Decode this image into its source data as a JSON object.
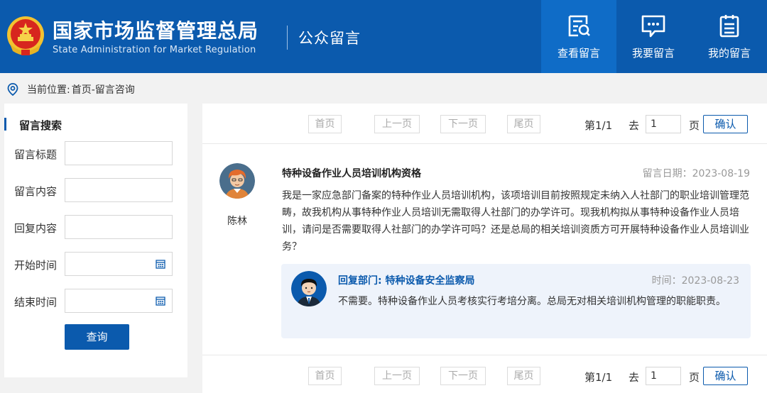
{
  "header": {
    "org_name_cn": "国家市场监督管理总局",
    "org_name_en": "State Administration for Market Regulation",
    "section_title": "公众留言",
    "nav": [
      {
        "label": "查看留言",
        "icon": "view-messages-icon",
        "active": true
      },
      {
        "label": "我要留言",
        "icon": "write-message-icon",
        "active": false
      },
      {
        "label": "我的留言",
        "icon": "my-messages-icon",
        "active": false
      }
    ]
  },
  "breadcrumb": {
    "label": "当前位置:",
    "path": "首页-留言咨询"
  },
  "sidebar": {
    "title": "留言搜索",
    "fields": [
      {
        "label": "留言标题",
        "value": ""
      },
      {
        "label": "留言内容",
        "value": ""
      },
      {
        "label": "回复内容",
        "value": ""
      },
      {
        "label": "开始时间",
        "value": ""
      },
      {
        "label": "结束时间",
        "value": ""
      }
    ],
    "search_label": "查询"
  },
  "pager": {
    "first": "首页",
    "prev": "上一页",
    "next": "下一页",
    "last": "尾页",
    "page_info": "第1/1",
    "goto_label": "去",
    "page_input": "1",
    "page_unit": "页",
    "confirm": "确认"
  },
  "message": {
    "user": "陈林",
    "title": "特种设备作业人员培训机构资格",
    "date": "留言日期：2023-08-19",
    "body": "我是一家应急部门备案的特种作业人员培训机构，该项培训目前按照规定未纳入人社部门的职业培训管理范畴，故我机构从事特种作业人员培训无需取得人社部门的办学许可。现我机构拟从事特种设备作业人员培训，请问是否需要取得人社部门的办学许可吗？还是总局的相关培训资质方可开展特种设备作业人员培训业务？"
  },
  "reply": {
    "dept": "回复部门: 特种设备安全监察局",
    "time": "时间：2023-08-23",
    "body": "不需要。特种设备作业人员考核实行考培分离。总局无对相关培训机构管理的职能职责。"
  },
  "colors": {
    "brand_blue": "#0b5aad",
    "active_nav": "#0f6cc7",
    "reply_bg": "#eef3fb"
  }
}
